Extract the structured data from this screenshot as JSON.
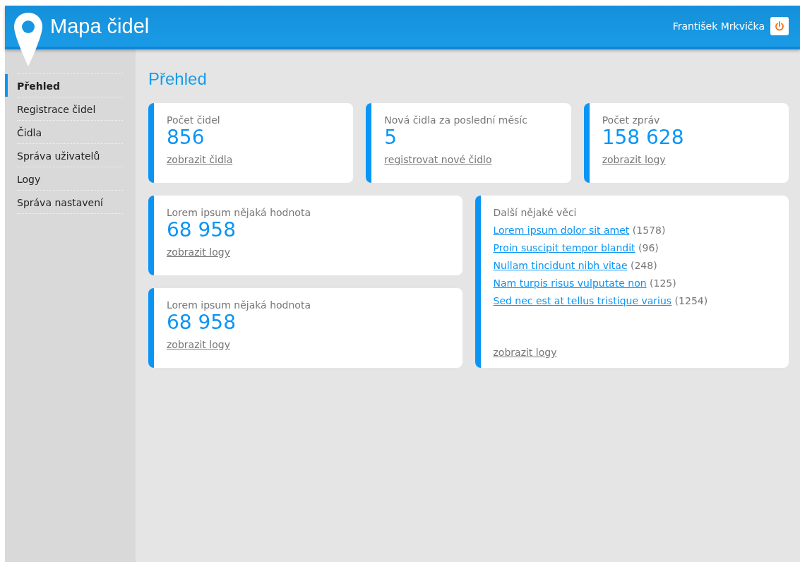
{
  "header": {
    "title": "Mapa čidel",
    "user": "František Mrkvička"
  },
  "sidebar": {
    "items": [
      {
        "label": "Přehled",
        "selected": true
      },
      {
        "label": "Registrace čidel",
        "selected": false
      },
      {
        "label": "Čidla",
        "selected": false
      },
      {
        "label": "Správa uživatelů",
        "selected": false
      },
      {
        "label": "Logy",
        "selected": false
      },
      {
        "label": "Správa nastavení",
        "selected": false
      }
    ]
  },
  "page_title": "Přehled",
  "top_cards": [
    {
      "label": "Počet čidel",
      "value": "856",
      "link": "zobrazit čidla"
    },
    {
      "label": "Nová čidla za poslední měsíc",
      "value": "5",
      "link": "registrovat nové čidlo"
    },
    {
      "label": "Počet zpráv",
      "value": "158 628",
      "link": "zobrazit logy"
    }
  ],
  "left_cards": [
    {
      "label": "Lorem ipsum nějaká hodnota",
      "value": "68 958",
      "link": "zobrazit logy"
    },
    {
      "label": "Lorem ipsum nějaká hodnota",
      "value": "68 958",
      "link": "zobrazit logy"
    }
  ],
  "list_card": {
    "label": "Další nějaké věci",
    "items": [
      {
        "text": "Lorem ipsum dolor sit amet",
        "count": "(1578)"
      },
      {
        "text": "Proin suscipit tempor blandit",
        "count": "(96)"
      },
      {
        "text": "Nullam tincidunt nibh vitae",
        "count": "(248)"
      },
      {
        "text": "Nam turpis risus vulputate non",
        "count": "(125)"
      },
      {
        "text": "Sed nec est at tellus tristique varius",
        "count": "(1254)"
      }
    ],
    "link": "zobrazit logy"
  }
}
